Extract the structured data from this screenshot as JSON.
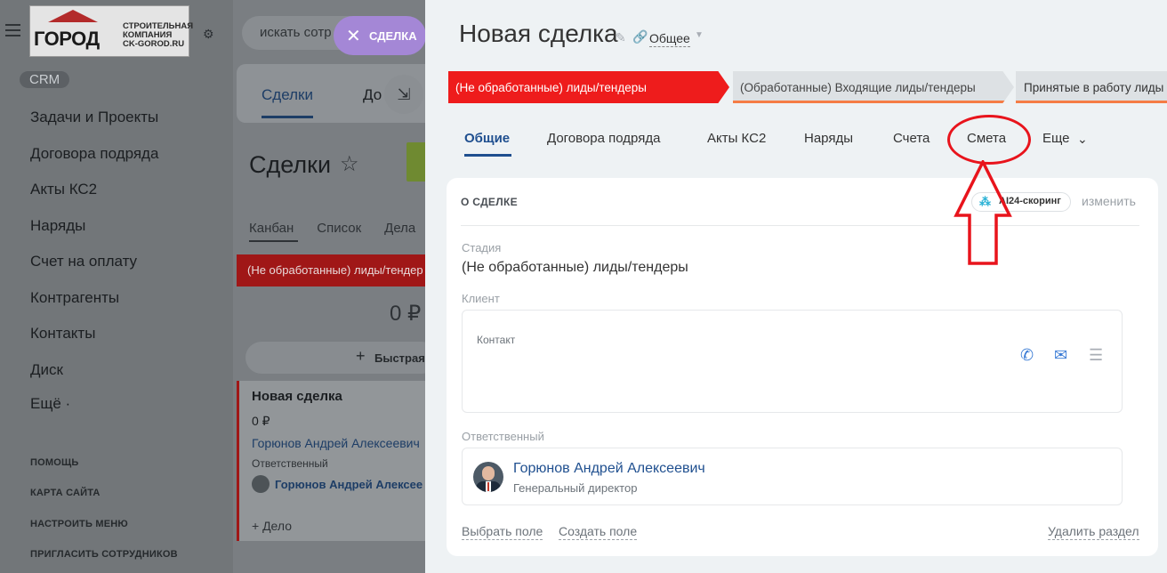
{
  "background": {
    "logo": {
      "word": "ГОРОД",
      "sub1": "СТРОИТЕЛЬНАЯ",
      "sub2": "КОМПАНИЯ",
      "sub3": "CK-GOROD.RU"
    },
    "crm_badge": "CRM",
    "nav_items": [
      "Задачи и Проекты",
      "Договора подряда",
      "Акты КС2",
      "Наряды",
      "Счет на оплату",
      "Контрагенты",
      "Контакты",
      "Диск",
      "Ещё ·"
    ],
    "nav_footer": [
      "ПОМОЩЬ",
      "КАРТА САЙТА",
      "НАСТРОИТЬ МЕНЮ",
      "ПРИГЛАСИТЬ СОТРУДНИКОВ"
    ],
    "search_placeholder": "искать сотр",
    "deal_chip": "СДЕЛКА",
    "top_tab_active": "Сделки",
    "top_tab_next": "До",
    "page_title": "Сделки",
    "view_tabs": [
      "Канбан",
      "Список",
      "Дела"
    ],
    "stage_column": "(Не обработанные) лиды/тендер",
    "column_sum": "0 ₽",
    "quick_add": "Быстрая",
    "kanban_card": {
      "title": "Новая сделка",
      "sum": "0 ₽",
      "person": "Горюнов Андрей Алексеевич",
      "label": "Ответственный",
      "assignee": "Горюнов Андрей Алексее",
      "add_activity": "+ Дело"
    }
  },
  "slider": {
    "title": "Новая сделка",
    "category": "Общее",
    "stages": [
      "(Не обработанные) лиды/тендеры",
      "(Обработанные) Входящие лиды/тендеры",
      "Принятые в работу лиды"
    ],
    "tabs": [
      "Общие",
      "Договора подряда",
      "Акты КС2",
      "Наряды",
      "Счета",
      "Смета",
      "Еще"
    ],
    "section": {
      "title": "О СДЕЛКЕ",
      "ai_badge": "AI24-скоринг",
      "edit_link": "изменить",
      "stage_label": "Стадия",
      "stage_value": "(Не обработанные) лиды/тендеры",
      "client_label": "Клиент",
      "contact_placeholder": "Контакт",
      "responsible_label": "Ответственный",
      "responsible_name": "Горюнов Андрей Алексеевич",
      "responsible_position": "Генеральный директор",
      "select_field": "Выбрать поле",
      "create_field": "Создать поле",
      "delete_section": "Удалить раздел"
    }
  },
  "icons": {
    "hamburger": "menu-icon",
    "settings": "sliders-icon",
    "star": "star-icon",
    "pencil": "pencil-icon",
    "link": "link-icon",
    "phone": "phone-icon",
    "mail": "mail-icon",
    "chat": "chat-icon",
    "ai": "ai-scoring-icon"
  },
  "colors": {
    "stage_active": "#ee1c1c",
    "stage_progress": "#f57c45",
    "accent": "#1f4f8f",
    "annotation": "#e8141c"
  }
}
